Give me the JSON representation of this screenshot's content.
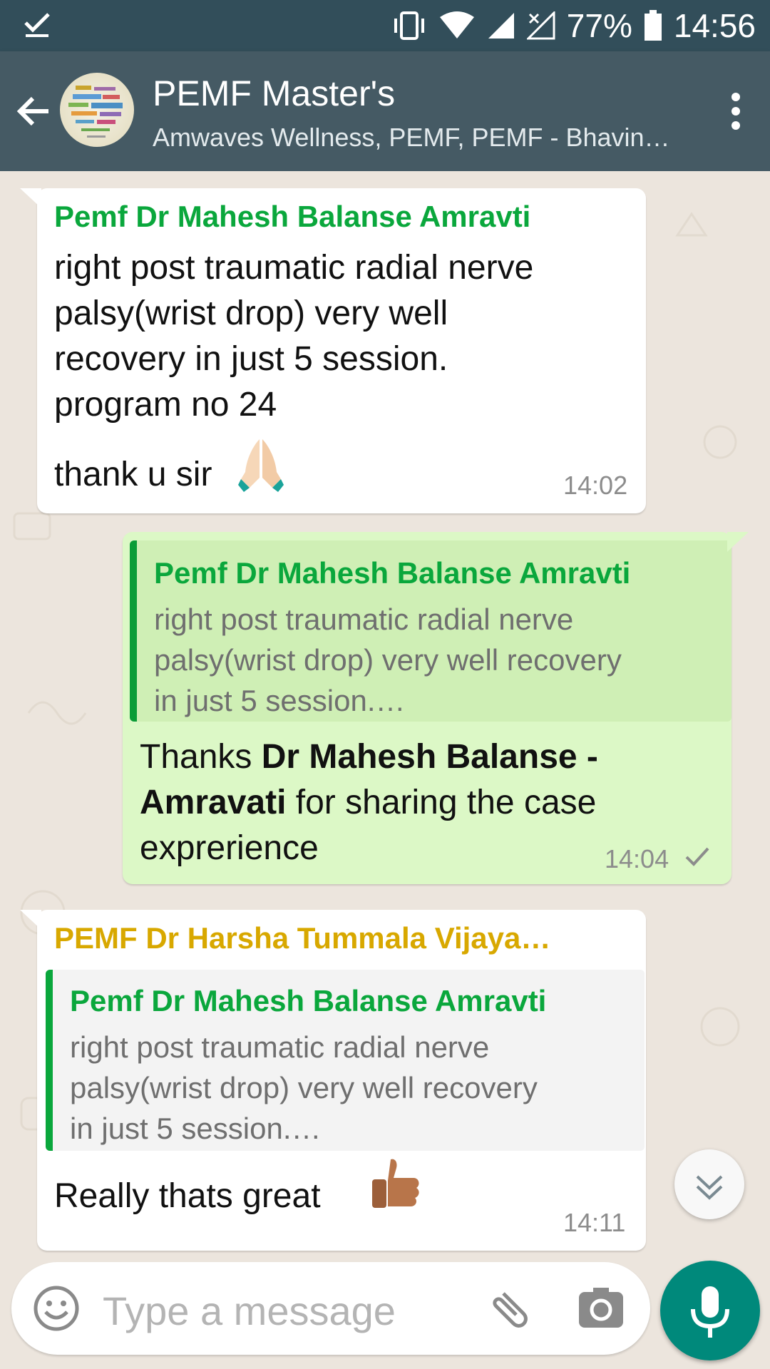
{
  "status_bar": {
    "battery": "77%",
    "time": "14:56",
    "icons": [
      "download-done-icon",
      "vibrate-icon",
      "wifi-icon",
      "signal-icon",
      "no-signal-icon",
      "battery-icon"
    ]
  },
  "header": {
    "title": "PEMF Master's",
    "subtitle": "Amwaves Wellness, PEMF, PEMF - Bhavin…",
    "icons": [
      "back-arrow-icon",
      "group-avatar",
      "more-vert-icon"
    ]
  },
  "messages": [
    {
      "direction": "incoming",
      "sender": "Pemf Dr Mahesh Balanse Amravti",
      "sender_color": "#0aa73c",
      "text_lines": [
        "right post traumatic radial nerve",
        "palsy(wrist drop) very well",
        "recovery in just 5 session.",
        "program no 24"
      ],
      "last_line": "thank u sir",
      "emoji": "folded-hands-emoji",
      "time": "14:02"
    },
    {
      "direction": "outgoing",
      "quote": {
        "sender": "Pemf Dr Mahesh Balanse Amravti",
        "lines": [
          "right post traumatic radial nerve",
          "palsy(wrist drop) very well recovery",
          "in just 5 session.…"
        ]
      },
      "line1_plain": "Thanks ",
      "line1_bold": "Dr Mahesh Balanse -",
      "line2_bold": "Amravati",
      "line2_plain": " for sharing the case",
      "line3": "exprerience",
      "time": "14:04",
      "status_icon": "single-check-icon"
    },
    {
      "direction": "incoming",
      "sender": "PEMF Dr Harsha Tummala Vijaya…",
      "sender_color": "#d8a800",
      "quote": {
        "sender": "Pemf Dr Mahesh Balanse Amravti",
        "lines": [
          "right post traumatic radial nerve",
          "palsy(wrist drop) very well recovery",
          "in just 5 session.…"
        ]
      },
      "text": "Really thats great",
      "emoji": "thumbs-up-emoji",
      "time": "14:11"
    }
  ],
  "composer": {
    "placeholder": "Type a message",
    "icons": [
      "emoji-icon",
      "attach-icon",
      "camera-icon",
      "mic-icon",
      "scroll-down-icon"
    ]
  },
  "colors": {
    "status_bar": "#324e5a",
    "app_bar": "#455a64",
    "chat_bg": "#ece5dd",
    "outgoing_bubble": "#dcf8c6",
    "mic_button": "#00897b"
  }
}
